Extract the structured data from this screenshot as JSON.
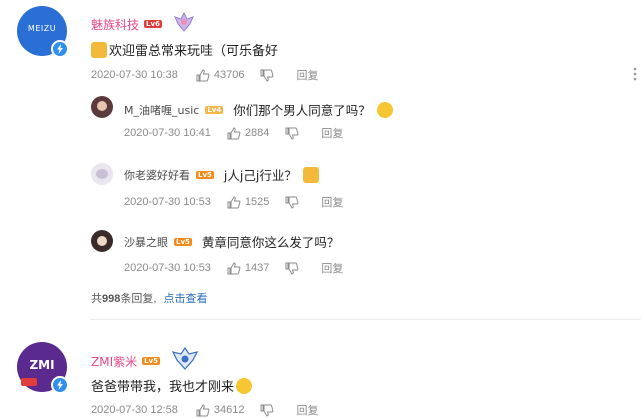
{
  "comments": [
    {
      "user": "魅族科技",
      "level": "Lv6",
      "text": "欢迎雷总常来玩哇（可乐备好",
      "time": "2020-07-30 10:38",
      "likes": "43706",
      "reply_label": "回复",
      "avatar_text": "MEIZU",
      "replies": [
        {
          "user": "M_油啫喱_usic",
          "level": "Lv4",
          "text": "你们那个男人同意了吗？",
          "time": "2020-07-30 10:41",
          "likes": "2884",
          "reply_label": "回复"
        },
        {
          "user": "你老婆好好看",
          "level": "Lv5",
          "text": "j人j己j行业？",
          "time": "2020-07-30 10:53",
          "likes": "1525",
          "reply_label": "回复"
        },
        {
          "user": "沙暴之眼",
          "level": "Lv5",
          "text": "黄章同意你这么发了吗？",
          "time": "2020-07-30 10:53",
          "likes": "1437",
          "reply_label": "回复"
        }
      ],
      "summary": {
        "prefix": "共",
        "count": "998",
        "suffix": "条回复,",
        "link": "点击查看"
      }
    },
    {
      "user": "ZMI紫米",
      "level": "Lv5",
      "text": "爸爸带带我，我也才刚来",
      "time": "2020-07-30 12:58",
      "likes": "34612",
      "reply_label": "回复",
      "avatar_text": "ZMI"
    }
  ],
  "colors": {
    "username_vip": "#e8478b",
    "link": "#2a6fbd",
    "meta": "#8a8a8a",
    "verified": "#2f8ff0",
    "meizu_avatar": "#2a6fd6",
    "zmi_avatar": "#5b2a8f"
  },
  "icons": {
    "like": "thumb-up-icon",
    "dislike": "thumb-down-icon",
    "more": "vertical-dots-icon",
    "verified": "lightning-icon"
  }
}
